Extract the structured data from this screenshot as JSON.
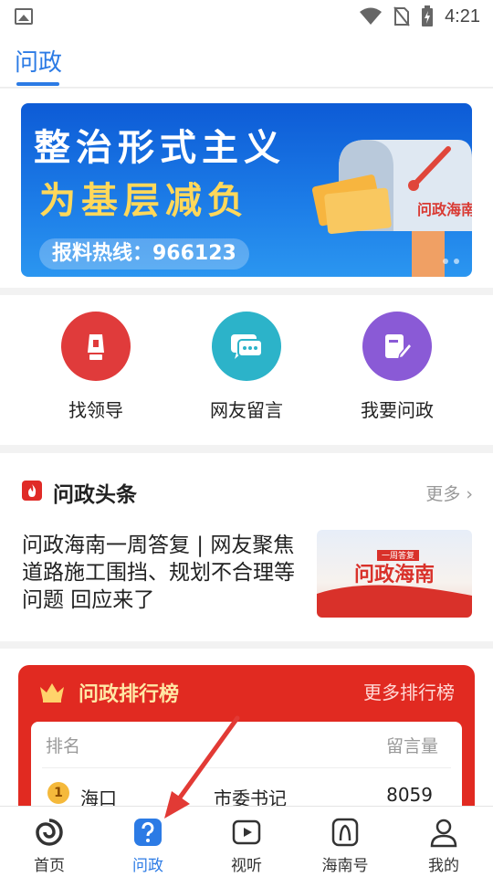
{
  "status_bar": {
    "time": "4:21"
  },
  "header": {
    "tab_label": "问政"
  },
  "banner": {
    "line1": "整治形式主义",
    "line2": "为基层减负",
    "hotline": "报料热线：966123",
    "logo_text": "问政海南"
  },
  "actions": [
    {
      "label": "找领导",
      "icon": "leader-icon",
      "color": "#e03b3b"
    },
    {
      "label": "网友留言",
      "icon": "chat-icon",
      "color": "#2cb3c9"
    },
    {
      "label": "我要问政",
      "icon": "edit-icon",
      "color": "#8a5ad6"
    }
  ],
  "headlines": {
    "title": "问政头条",
    "more": "更多",
    "article_title": "问政海南一周答复 | 网友聚焦道路施工围挡、规划不合理等问题 回应来了",
    "thumb_tag": "一周答复",
    "thumb_logo": "问政海南"
  },
  "ranking": {
    "title": "问政排行榜",
    "more": "更多排行榜",
    "col_rank": "排名",
    "col_count": "留言量",
    "rows": [
      {
        "rank": "1",
        "city": "海口",
        "role": "市委书记",
        "count": "8059"
      }
    ]
  },
  "bottom_nav": [
    {
      "label": "首页",
      "icon": "home-swirl-icon",
      "active": false
    },
    {
      "label": "问政",
      "icon": "question-icon",
      "active": true
    },
    {
      "label": "视听",
      "icon": "play-icon",
      "active": false
    },
    {
      "label": "海南号",
      "icon": "hainan-icon",
      "active": false
    },
    {
      "label": "我的",
      "icon": "user-icon",
      "active": false
    }
  ],
  "colors": {
    "accent": "#2c7be5",
    "rank_red": "#e12a21"
  }
}
